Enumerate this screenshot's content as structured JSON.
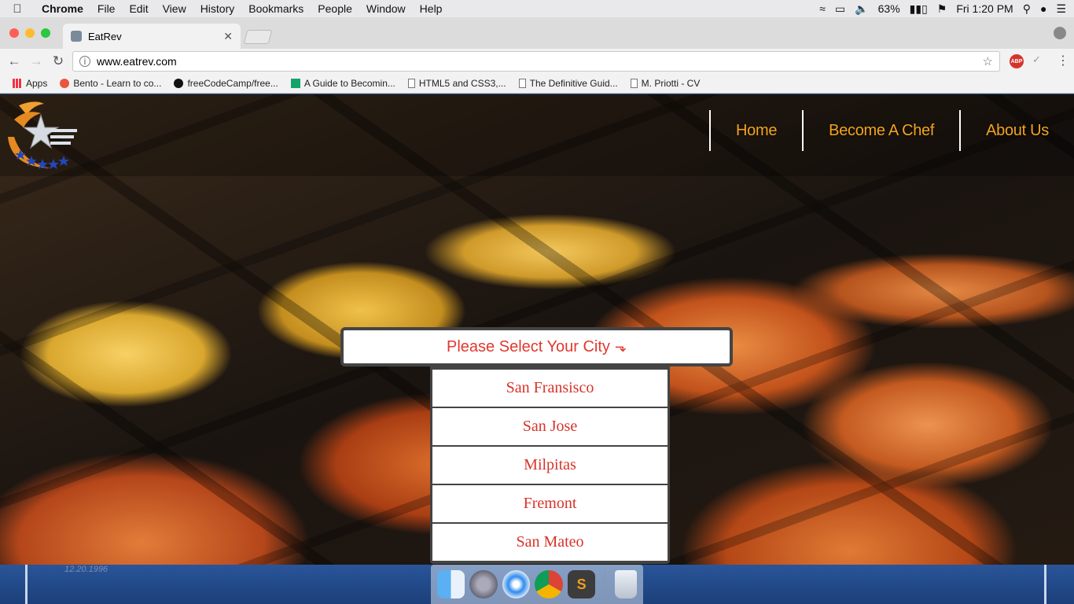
{
  "menubar": {
    "app": "Chrome",
    "items": [
      "File",
      "Edit",
      "View",
      "History",
      "Bookmarks",
      "People",
      "Window",
      "Help"
    ],
    "battery": "63%",
    "clock": "Fri 1:20 PM"
  },
  "tab": {
    "title": "EatRev"
  },
  "toolbar": {
    "url": "www.eatrev.com"
  },
  "bookmarks": [
    {
      "label": "Apps",
      "icon": "apps-icon"
    },
    {
      "label": "Bento - Learn to co...",
      "icon": "bento-icon"
    },
    {
      "label": "freeCodeCamp/free...",
      "icon": "github-icon"
    },
    {
      "label": "A Guide to Becomin...",
      "icon": "medium-icon"
    },
    {
      "label": "HTML5 and CSS3,...",
      "icon": "document-icon"
    },
    {
      "label": "The Definitive Guid...",
      "icon": "document-icon"
    },
    {
      "label": "M. Priotti - CV",
      "icon": "document-icon"
    }
  ],
  "site": {
    "nav": [
      "Home",
      "Become A Chef",
      "About Us"
    ],
    "city_select": {
      "label": "Please Select Your City",
      "options": [
        "San Fransisco",
        "San Jose",
        "Milpitas",
        "Fremont",
        "San Mateo"
      ]
    },
    "accent_color": "#e1382f",
    "nav_color": "#f3a41f"
  },
  "desktop": {
    "date_text": "12.20.1996"
  }
}
